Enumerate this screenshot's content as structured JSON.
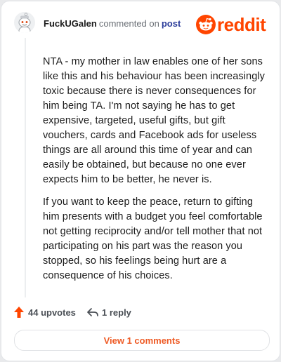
{
  "header": {
    "username": "FuckUGalen",
    "verb": "commented on",
    "post_link": "post",
    "logo_text": "reddit",
    "brand_color": "#ff4500"
  },
  "comment": {
    "paragraphs": [
      "NTA - my mother in law enables one of her sons like this and his behaviour has been increasingly toxic because there is never consequences for him being TA. I'm not saying he has to get expensive, targeted, useful gifts, but gift vouchers, cards and Facebook ads for useless things are all around this time of year and can easily be obtained, but because no one ever expects him to be better, he never is.",
      "If you want to keep the peace, return to gifting him presents with a budget you feel comfortable not getting reciprocity and/or tell mother that not participating on his part was the reason you stopped, so his feelings being hurt are a consequence of his choices."
    ]
  },
  "actions": {
    "upvotes_label": "44 upvotes",
    "upvote_icon": "arrow-up-icon",
    "reply_label": "1 reply",
    "reply_icon": "reply-arrow-icon"
  },
  "footer": {
    "view_comments_label": "View 1 comments"
  }
}
